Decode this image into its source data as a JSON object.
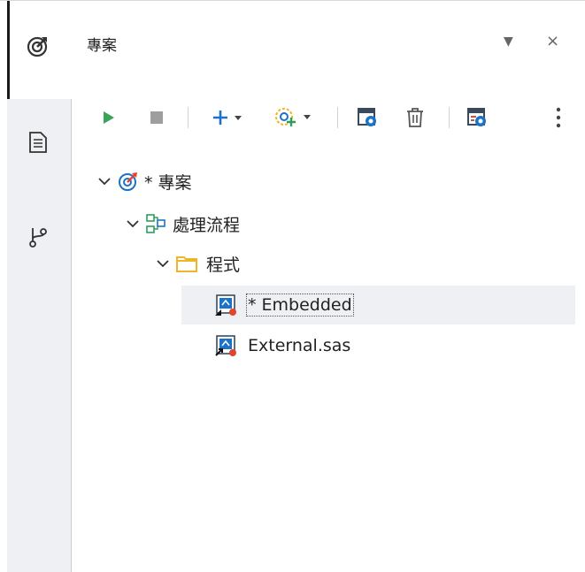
{
  "panel": {
    "title": "專案",
    "menu_label": "▼",
    "close_label": "×"
  },
  "sidebar": {
    "items": [
      {
        "name": "projects",
        "icon": "project-icon",
        "active": true
      },
      {
        "name": "document",
        "icon": "document-icon",
        "active": false
      },
      {
        "name": "git",
        "icon": "git-branch-icon",
        "active": false
      }
    ]
  },
  "toolbar": {
    "buttons": [
      {
        "name": "run",
        "icon": "play-icon"
      },
      {
        "name": "stop",
        "icon": "stop-icon"
      },
      {
        "name": "add",
        "icon": "plus-icon"
      },
      {
        "name": "add-task",
        "icon": "add-task-icon"
      },
      {
        "name": "properties",
        "icon": "properties-icon"
      },
      {
        "name": "delete",
        "icon": "trash-icon"
      },
      {
        "name": "flow-properties",
        "icon": "flow-properties-icon"
      },
      {
        "name": "more",
        "icon": "more-vertical-icon"
      }
    ]
  },
  "tree": {
    "nodes": [
      {
        "label": "* 專案",
        "level": 0,
        "expanded": true,
        "icon": "project-icon"
      },
      {
        "label": "處理流程",
        "level": 1,
        "expanded": true,
        "icon": "process-flow-icon"
      },
      {
        "label": "程式",
        "level": 2,
        "expanded": true,
        "icon": "folder-icon"
      },
      {
        "label": "* Embedded",
        "level": 3,
        "selected": true,
        "icon": "embedded-program-icon"
      },
      {
        "label": "External.sas",
        "level": 3,
        "selected": false,
        "icon": "external-program-icon"
      }
    ]
  },
  "colors": {
    "accent": "#1a73c8",
    "run_green": "#3aa35a",
    "stop_gray": "#9e9e9e",
    "folder": "#f0b429",
    "sidebar_bg": "#eef0f3",
    "selection_bg": "#eef0f3"
  }
}
